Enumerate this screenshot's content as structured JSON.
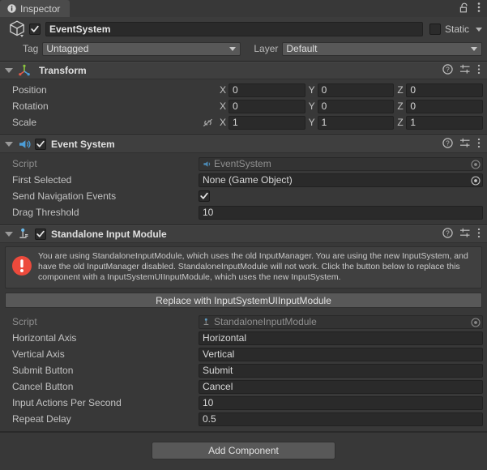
{
  "window": {
    "tab_label": "Inspector",
    "tab_icon": "info-icon",
    "lock_icon": "lock-open-icon",
    "menu_icon": "kebab-menu-icon"
  },
  "gameobject": {
    "icon": "cube-icon",
    "enabled": true,
    "name": "EventSystem",
    "static_label": "Static",
    "static_checked": false,
    "tag_label": "Tag",
    "tag_value": "Untagged",
    "layer_label": "Layer",
    "layer_value": "Default"
  },
  "components": [
    {
      "id": "transform",
      "title": "Transform",
      "icon": "transform-gizmo-icon",
      "has_enable_toggle": false,
      "expanded": true,
      "header_icons": [
        "help-icon",
        "preset-icon",
        "kebab-menu-icon"
      ],
      "vectors": [
        {
          "label": "Position",
          "x": "0",
          "y": "0",
          "z": "0",
          "link": false
        },
        {
          "label": "Rotation",
          "x": "0",
          "y": "0",
          "z": "0",
          "link": false
        },
        {
          "label": "Scale",
          "x": "1",
          "y": "1",
          "z": "1",
          "link": true,
          "link_icon": "link-off-icon"
        }
      ],
      "axis_labels": {
        "x": "X",
        "y": "Y",
        "z": "Z"
      }
    },
    {
      "id": "event-system",
      "title": "Event System",
      "icon": "event-system-icon",
      "has_enable_toggle": true,
      "enabled": true,
      "expanded": true,
      "header_icons": [
        "help-icon",
        "preset-icon",
        "kebab-menu-icon"
      ],
      "rows": [
        {
          "type": "objectref",
          "label": "Script",
          "value": "EventSystem",
          "readonly": true,
          "value_icon": "script-event-system-icon"
        },
        {
          "type": "objectref",
          "label": "First Selected",
          "value": "None (Game Object)",
          "readonly": false
        },
        {
          "type": "checkbox",
          "label": "Send Navigation Events",
          "checked": true
        },
        {
          "type": "text",
          "label": "Drag Threshold",
          "value": "10"
        }
      ]
    },
    {
      "id": "standalone-input-module",
      "title": "Standalone Input Module",
      "icon": "joystick-icon",
      "has_enable_toggle": true,
      "enabled": true,
      "expanded": true,
      "header_icons": [
        "help-icon",
        "preset-icon",
        "kebab-menu-icon"
      ],
      "helpbox": {
        "icon": "error-icon",
        "text": "You are using StandaloneInputModule, which uses the old InputManager. You are using the new InputSystem, and have the old InputManager disabled. StandaloneInputModule will not work. Click the button below to replace this component with a InputSystemUIInputModule, which uses the new InputSystem."
      },
      "replace_button_label": "Replace with InputSystemUIInputModule",
      "rows": [
        {
          "type": "objectref",
          "label": "Script",
          "value": "StandaloneInputModule",
          "readonly": true,
          "value_icon": "script-joystick-icon"
        },
        {
          "type": "text",
          "label": "Horizontal Axis",
          "value": "Horizontal"
        },
        {
          "type": "text",
          "label": "Vertical Axis",
          "value": "Vertical"
        },
        {
          "type": "text",
          "label": "Submit Button",
          "value": "Submit"
        },
        {
          "type": "text",
          "label": "Cancel Button",
          "value": "Cancel"
        },
        {
          "type": "text",
          "label": "Input Actions Per Second",
          "value": "10"
        },
        {
          "type": "text",
          "label": "Repeat Delay",
          "value": "0.5"
        }
      ]
    }
  ],
  "footer": {
    "add_component_label": "Add Component"
  },
  "colors": {
    "background": "#383838",
    "panel": "#3c3c3c",
    "component_header": "#3f3f3f",
    "field": "#2a2a2a",
    "dropdown": "#585858",
    "accent_blue": "#4c9ed9",
    "error_red": "#e8453c",
    "text": "#c4c4c4"
  }
}
